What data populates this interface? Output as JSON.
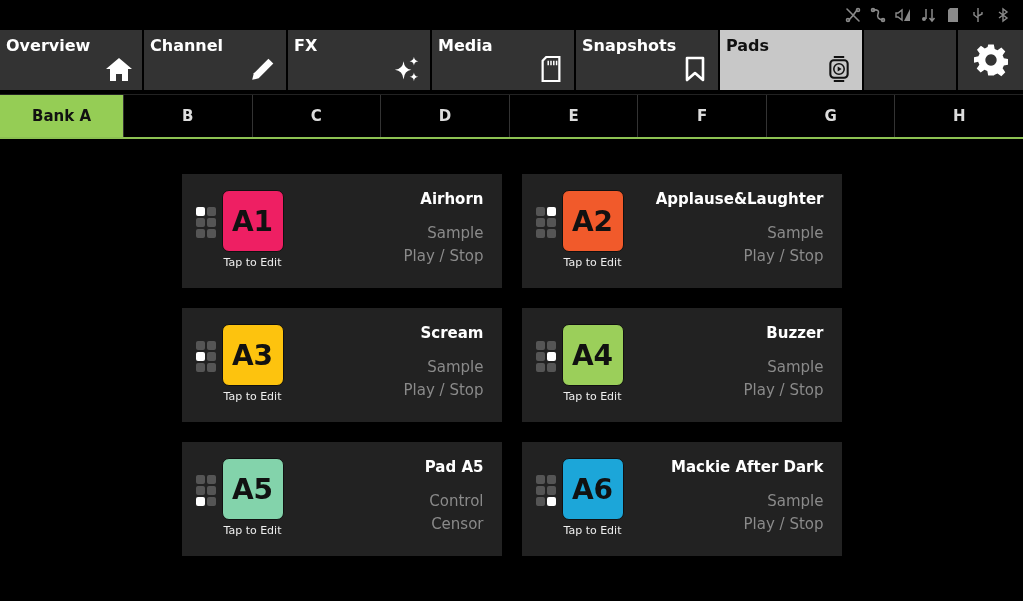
{
  "tabs": [
    {
      "label": "Overview",
      "selected": false
    },
    {
      "label": "Channel",
      "selected": false
    },
    {
      "label": "FX",
      "selected": false
    },
    {
      "label": "Media",
      "selected": false
    },
    {
      "label": "Snapshots",
      "selected": false
    },
    {
      "label": "Pads",
      "selected": true
    }
  ],
  "banks": [
    {
      "label": "Bank A",
      "selected": true
    },
    {
      "label": "B",
      "selected": false
    },
    {
      "label": "C",
      "selected": false
    },
    {
      "label": "D",
      "selected": false
    },
    {
      "label": "E",
      "selected": false
    },
    {
      "label": "F",
      "selected": false
    },
    {
      "label": "G",
      "selected": false
    },
    {
      "label": "H",
      "selected": false
    }
  ],
  "pads": [
    {
      "label": "A1",
      "color": "#ee1f63",
      "cells": [
        true,
        false,
        false,
        false,
        false,
        false
      ],
      "hint": "Tap to Edit",
      "name": "Airhorn",
      "type": "Sample",
      "action": "Play / Stop"
    },
    {
      "label": "A2",
      "color": "#f15a2b",
      "cells": [
        false,
        true,
        false,
        false,
        false,
        false
      ],
      "hint": "Tap to Edit",
      "name": "Applause&Laughter",
      "type": "Sample",
      "action": "Play / Stop"
    },
    {
      "label": "A3",
      "color": "#fdc30e",
      "cells": [
        false,
        false,
        true,
        false,
        false,
        false
      ],
      "hint": "Tap to Edit",
      "name": "Scream",
      "type": "Sample",
      "action": "Play / Stop"
    },
    {
      "label": "A4",
      "color": "#9bcf5a",
      "cells": [
        false,
        false,
        false,
        true,
        false,
        false
      ],
      "hint": "Tap to Edit",
      "name": "Buzzer",
      "type": "Sample",
      "action": "Play / Stop"
    },
    {
      "label": "A5",
      "color": "#83d3ab",
      "cells": [
        false,
        false,
        false,
        false,
        true,
        false
      ],
      "hint": "Tap to Edit",
      "name": "Pad A5",
      "type": "Control",
      "action": "Censor"
    },
    {
      "label": "A6",
      "color": "#1ca6d9",
      "cells": [
        false,
        false,
        false,
        false,
        false,
        true
      ],
      "hint": "Tap to Edit",
      "name": "Mackie After Dark",
      "type": "Sample",
      "action": "Play / Stop"
    }
  ]
}
